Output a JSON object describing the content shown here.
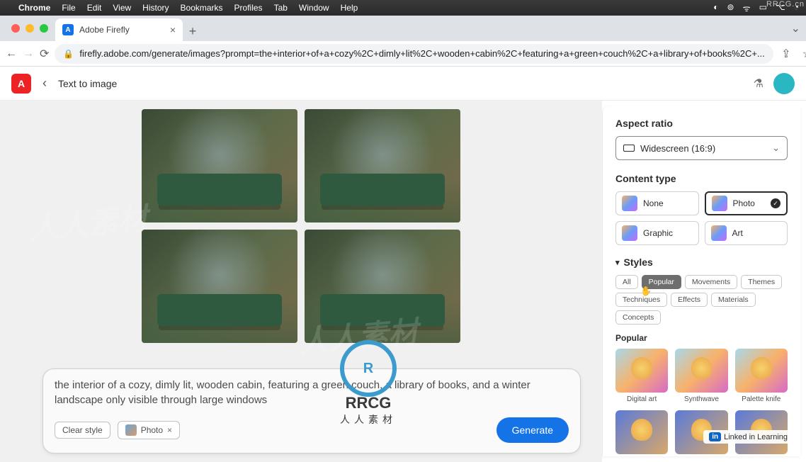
{
  "mac": {
    "app": "Chrome",
    "menus": [
      "File",
      "Edit",
      "View",
      "History",
      "Bookmarks",
      "Profiles",
      "Tab",
      "Window",
      "Help"
    ]
  },
  "browser": {
    "tab_title": "Adobe Firefly",
    "url": "firefly.adobe.com/generate/images?prompt=the+interior+of+a+cozy%2C+dimly+lit%2C+wooden+cabin%2C+featuring+a+green+couch%2C+a+library+of+books%2C+..."
  },
  "app": {
    "page_title": "Text to image"
  },
  "prompt": {
    "text": "the interior of a cozy, dimly lit, wooden cabin, featuring a green couch, a library of books, and a winter landscape only visible through large windows",
    "clear_style_label": "Clear style",
    "style_chip_label": "Photo",
    "generate_label": "Generate"
  },
  "sidebar": {
    "aspect_ratio": {
      "label": "Aspect ratio",
      "value": "Widescreen (16:9)"
    },
    "content_type": {
      "label": "Content type",
      "options": [
        "None",
        "Photo",
        "Graphic",
        "Art"
      ],
      "selected": "Photo"
    },
    "styles": {
      "label": "Styles",
      "tabs": [
        "All",
        "Popular",
        "Movements",
        "Themes",
        "Techniques",
        "Effects",
        "Materials",
        "Concepts"
      ],
      "active_tab": "Popular",
      "sub_label": "Popular",
      "items_row1": [
        "Digital art",
        "Synthwave",
        "Palette knife"
      ]
    }
  },
  "watermarks": {
    "site": "RRCG.cn",
    "center_main": "RRCG",
    "center_sub": "人人素材",
    "linkedin": "Linked in Learning"
  }
}
